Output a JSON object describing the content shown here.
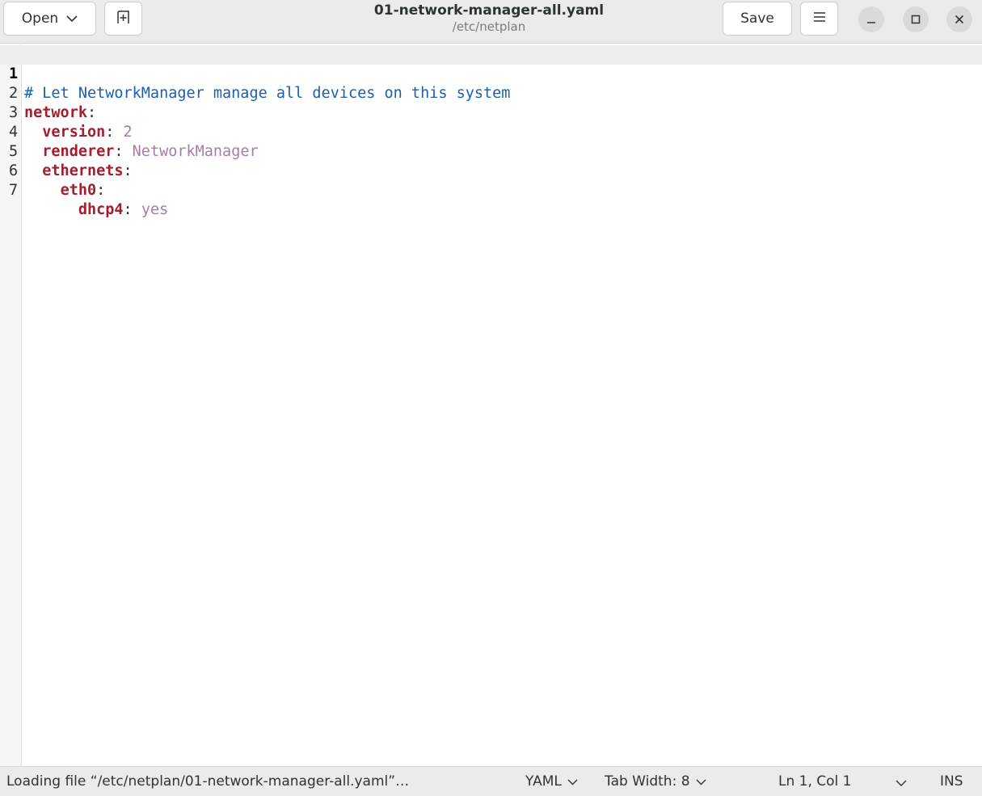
{
  "header": {
    "open_label": "Open",
    "title": "01-network-manager-all.yaml",
    "subtitle": "/etc/netplan",
    "save_label": "Save",
    "icons": {
      "open_dropdown": "chevron-down-icon",
      "new_tab": "new-tab-icon",
      "menu": "hamburger-menu-icon",
      "minimize": "minimize-icon",
      "maximize": "maximize-icon",
      "close": "close-icon"
    }
  },
  "editor": {
    "current_line": 1,
    "lines": [
      {
        "num": "1",
        "comment": "# Let NetworkManager manage all devices on this system"
      },
      {
        "num": "2",
        "indent": "",
        "key": "network",
        "sep": ":",
        "value": ""
      },
      {
        "num": "3",
        "indent": "  ",
        "key": "version",
        "sep": ": ",
        "value": "2"
      },
      {
        "num": "4",
        "indent": "  ",
        "key": "renderer",
        "sep": ": ",
        "value": "NetworkManager"
      },
      {
        "num": "5",
        "indent": "  ",
        "key": "ethernets",
        "sep": ":",
        "value": ""
      },
      {
        "num": "6",
        "indent": "    ",
        "key": "eth0",
        "sep": ":",
        "value": ""
      },
      {
        "num": "7",
        "indent": "      ",
        "key": "dhcp4",
        "sep": ": ",
        "value": "yes"
      }
    ]
  },
  "statusbar": {
    "message": "Loading file “/etc/netplan/01-network-manager-all.yaml”…",
    "language": "YAML",
    "tab_width": "Tab Width: 8",
    "position": "Ln 1, Col 1",
    "mode": "INS"
  },
  "colors": {
    "comment": "#1a5fb4",
    "key": "#a51d2d",
    "value": "#a77ca8",
    "headerbar": "#ebebeb"
  }
}
